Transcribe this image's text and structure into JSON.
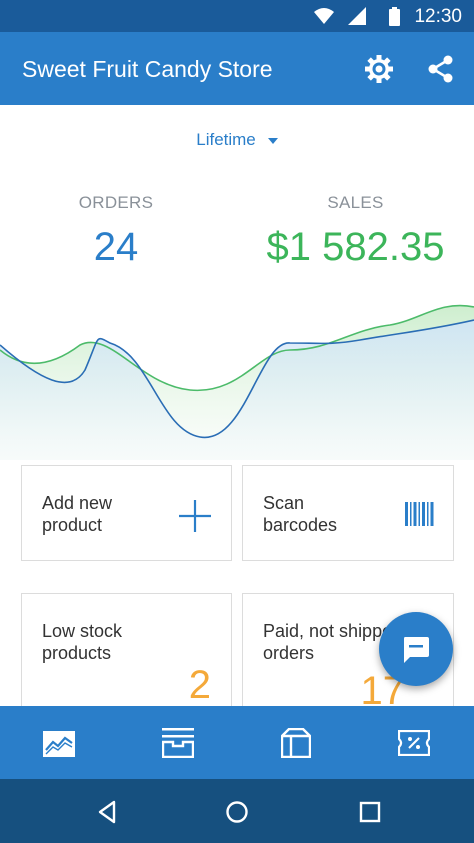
{
  "status_bar": {
    "time": "12:30",
    "icons": [
      "wifi-icon",
      "signal-icon",
      "battery-icon"
    ]
  },
  "app_bar": {
    "title": "Sweet Fruit Candy Store",
    "actions": [
      "settings-icon",
      "share-icon"
    ]
  },
  "period": {
    "selected": "Lifetime"
  },
  "stats": {
    "orders": {
      "label": "ORDERS",
      "value": "24"
    },
    "sales": {
      "label": "SALES",
      "value": "$1 582.35"
    }
  },
  "cards": {
    "add_product": {
      "label_line1": "Add new",
      "label_line2": "product",
      "icon": "plus-icon"
    },
    "scan": {
      "label_line1": "Scan",
      "label_line2": "barcodes",
      "icon": "barcode-icon"
    },
    "low_stock": {
      "label_line1": "Low stock",
      "label_line2": "products",
      "count": "2"
    },
    "paid_not_shipped": {
      "label_line1": "Paid, not shipped",
      "label_line2": "orders",
      "count": "17"
    }
  },
  "fab": {
    "icon": "chat-icon"
  },
  "bottom_nav": {
    "tabs": [
      "dashboard-icon",
      "orders-icon",
      "products-icon",
      "coupons-icon"
    ],
    "selected": "dashboard-icon"
  },
  "colors": {
    "primary": "#2a7ec9",
    "status_bar": "#1a5b9a",
    "sales_green": "#3cb55a",
    "count_orange": "#f4a93a",
    "system_nav": "#16507f"
  }
}
